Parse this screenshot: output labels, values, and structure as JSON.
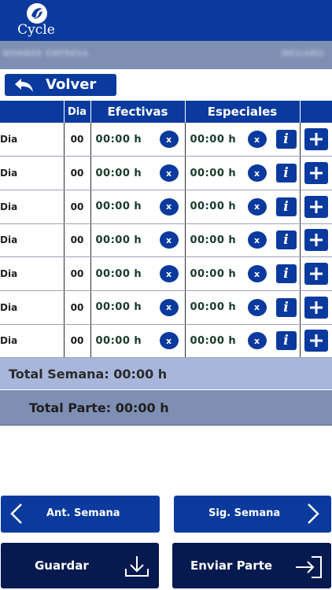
{
  "header": {
    "logo_text": "Cycle"
  },
  "company_bar": {
    "left_text": "NOMBRE EMPRESA",
    "right_text": "MES/AÑO"
  },
  "back_button": {
    "label": "Volver"
  },
  "table": {
    "headers": [
      "",
      "Dia",
      "Efectivas",
      "Especiales",
      ""
    ],
    "rows": [
      {
        "day": "Dia",
        "num": "00",
        "efectivas": "00:00 h",
        "especiales": "00:00 h"
      },
      {
        "day": "Dia",
        "num": "00",
        "efectivas": "00:00 h",
        "especiales": "00:00 h"
      },
      {
        "day": "Dia",
        "num": "00",
        "efectivas": "00:00 h",
        "especiales": "00:00 h"
      },
      {
        "day": "Dia",
        "num": "00",
        "efectivas": "00:00 h",
        "especiales": "00:00 h"
      },
      {
        "day": "Dia",
        "num": "00",
        "efectivas": "00:00 h",
        "especiales": "00:00 h"
      },
      {
        "day": "Dia",
        "num": "00",
        "efectivas": "00:00 h",
        "especiales": "00:00 h"
      },
      {
        "day": "Dia",
        "num": "00",
        "efectivas": "00:00 h",
        "especiales": "00:00 h"
      }
    ],
    "clear_label": "x",
    "info_label": "i"
  },
  "totals": {
    "week": "Total Semana: 00:00 h",
    "part": "Total Parte: 00:00 h"
  },
  "nav": {
    "prev_label": "Ant. Semana",
    "next_label": "Sig. Semana"
  },
  "actions": {
    "save_label": "Guardar",
    "send_label": "Enviar Parte"
  },
  "colors": {
    "primary": "#0b3a9e",
    "dark": "#071a4f",
    "band_light": "#a9b6dc",
    "band_mid": "#7f8fb4"
  }
}
